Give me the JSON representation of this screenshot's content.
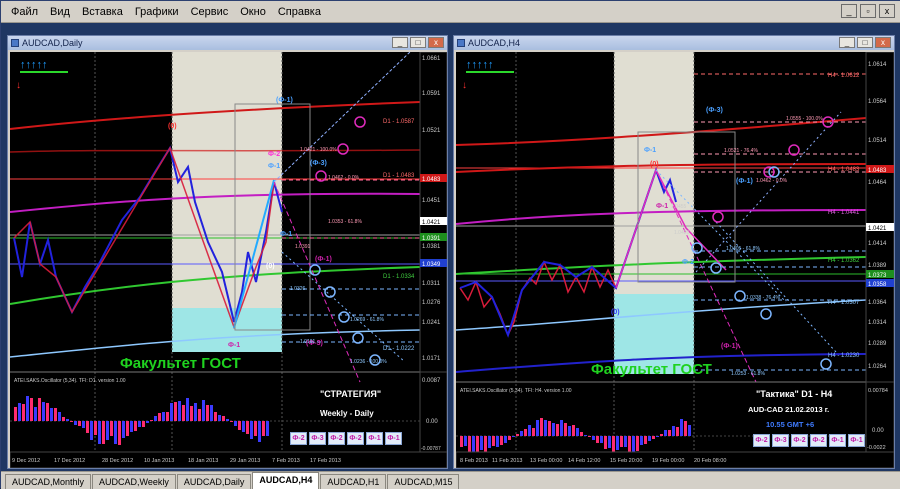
{
  "menu": [
    "Файл",
    "Вид",
    "Вставка",
    "Графики",
    "Сервис",
    "Окно",
    "Справка"
  ],
  "left_window": {
    "title": "AUDCAD,Daily",
    "price_ticks": [
      "1.0661",
      "1.0591",
      "1.0521",
      "1.0451",
      "1.0381",
      "1.0311",
      "1.0276",
      "1.0241",
      "1.0171"
    ],
    "price_markers": [
      "1.0483",
      "1.0421",
      "1.0391",
      "1.0349"
    ],
    "date_ticks": [
      "9 Dec 2012",
      "17 Dec 2012",
      "28 Dec 2012",
      "10 Jan 2013",
      "18 Jan 2013",
      "29 Jan 2013",
      "7 Feb 2013",
      "17 Feb 2013"
    ],
    "level_labels": [
      "D1 - 1.0587",
      "D1 - 1.0483",
      "D1 - 1.0334",
      "D1 - 1.0222"
    ],
    "fib_labels": [
      "1.0421 - 100.0%",
      "1.0462 - 0.0%",
      "1.0391",
      "1.0353 - 61.8%",
      "1.0326",
      "1.0269 - 61.8%",
      "1.0236 - 100.0%",
      "1.0191"
    ],
    "wave_labels": [
      "(Ф-1)",
      "Ф-2",
      "Ф-1",
      "(Ф-3)",
      "(0)",
      "(0)",
      "Ф-1",
      "(Ф-3)",
      "(Ф-1)",
      "Ф-1"
    ],
    "watermark": "Факультет ГОСТ",
    "oscillator_title": "ATEI.SAKS.Oscillator (5,34). TFI: D1. version 1.00",
    "osc_ticks": [
      "0.0087",
      "0.00",
      "-0.00787"
    ],
    "strategy_title": "\"СТРАТЕГИЯ\"",
    "strategy_sub": "Weekly - Daily",
    "buttons": [
      "Ф-2",
      "Ф-3",
      "Ф-2",
      "Ф-2",
      "Ф-1",
      "Ф-1"
    ],
    "arrows": "↑↑↑↑↑"
  },
  "right_window": {
    "title": "AUDCAD,H4",
    "price_ticks": [
      "1.0614",
      "1.0564",
      "1.0514",
      "1.0464",
      "1.0414",
      "1.0389",
      "1.0364",
      "1.0314",
      "1.0289",
      "1.0264"
    ],
    "price_markers": [
      "1.0483",
      "1.0421",
      "1.0373",
      "1.0358"
    ],
    "date_ticks": [
      "8 Feb 2013",
      "11 Feb 2013",
      "13 Feb 00:00",
      "14 Feb 12:00",
      "15 Feb 20:00",
      "19 Feb 00:00",
      "20 Feb 08:00"
    ],
    "level_labels": [
      "H4 - 1.0612",
      "H4 - 1.0483",
      "H4 - 1.0441",
      "H4 - 1.0362",
      "H4 - 1.0307",
      "H4 - 1.0230"
    ],
    "fib_labels": [
      "1.0555 - 100.0%",
      "1.0521 - 76.4%",
      "1.0462 - 0.0%",
      "1.0455",
      "1.0420",
      "1.0405 - 61.8%",
      "1.0338 - 76.4%",
      "1.0253 - 61.8%"
    ],
    "wave_labels": [
      "(Ф-3)",
      "Ф-1",
      "(0)",
      "(Ф-1)",
      "Ф-1",
      "Ф-2",
      "(0)",
      "(Ф-1)"
    ],
    "watermark": "Факультет ГОСТ",
    "oscillator_title": "ATEI.SAKS.Oscillator (5,34). TFI: H4. version 1.00",
    "osc_ticks": [
      "0.00784",
      "0.00",
      "-0.0022"
    ],
    "tactic_title": "\"Тактика\"   D1 - H4",
    "tactic_line1": "AUD-CAD    21.02.2013  г.",
    "tactic_line2": "10.55  GMT +6",
    "buttons": [
      "Ф-2",
      "Ф-3",
      "Ф-2",
      "Ф-2",
      "Ф-1",
      "Ф-1"
    ],
    "arrows": "↑↑↑↑↑"
  },
  "tabs": [
    "AUDCAD,Monthly",
    "AUDCAD,Weekly",
    "AUDCAD,Daily",
    "AUDCAD,H4",
    "AUDCAD,H1",
    "AUDCAD,M15"
  ],
  "active_tab": 3
}
